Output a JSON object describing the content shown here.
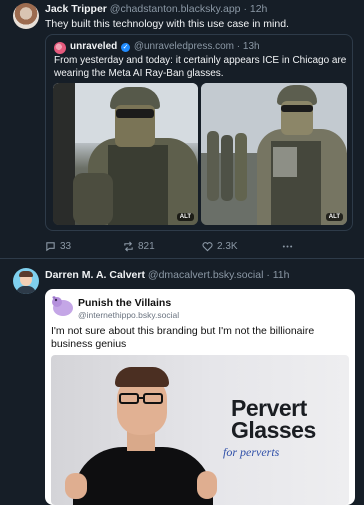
{
  "post1": {
    "author_name": "Jack Tripper",
    "author_handle": "@chadstanton.blacksky.app",
    "time": "12h",
    "separator": "·",
    "text": "They built this technology with this use case in mind.",
    "quote": {
      "author_name": "unraveled",
      "author_handle": "@unraveledpress.com",
      "time": "13h",
      "text": "From yesterday and today: it certainly appears ICE in Chicago are wearing the Meta AI Ray-Ban glasses.",
      "alt_badge": "ALT"
    },
    "actions": {
      "replies": "33",
      "reposts": "821",
      "likes": "2.3K"
    }
  },
  "post2": {
    "author_name": "Darren M. A. Calvert",
    "author_handle": "@dmacalvert.bsky.social",
    "time": "11h",
    "separator": "·",
    "embed": {
      "author_name": "Punish the Villains",
      "author_handle": "@internethippo.bsky.social",
      "text": "I'm not sure about this branding but I'm not the billionaire business genius",
      "image_title_line1": "Pervert",
      "image_title_line2": "Glasses",
      "image_subtitle": "for perverts"
    }
  },
  "colors": {
    "background": "#161e27",
    "muted_text": "#8b98a5",
    "verified_blue": "#208bfe",
    "divider": "#2e3b49"
  }
}
